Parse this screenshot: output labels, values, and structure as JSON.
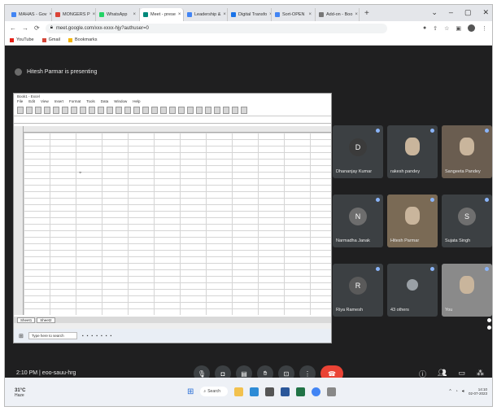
{
  "browser": {
    "tabs": [
      {
        "label": "MAHAS - Gov",
        "fav": "#4285f4"
      },
      {
        "label": "MONGERS P",
        "fav": "#db4437"
      },
      {
        "label": "WhatsApp",
        "fav": "#25d366"
      },
      {
        "label": "Meet - prese",
        "fav": "#00897b",
        "active": true
      },
      {
        "label": "Leadership &",
        "fav": "#4285f4"
      },
      {
        "label": "Digital Transfo",
        "fav": "#1a73e8"
      },
      {
        "label": "Sort-OPEN",
        "fav": "#4285f4"
      },
      {
        "label": "Add-on - Boo",
        "fav": "#777777"
      }
    ],
    "url": "meet.google.com/xxx-xxxx-hjy?authuser=0",
    "bookmarks": [
      "YouTube",
      "Gmail",
      "Bookmarks"
    ]
  },
  "meet": {
    "presenter_banner": "Hitesh Parmar is presenting",
    "spreadsheet": {
      "title": "Book1 - Excel",
      "menu": [
        "File",
        "Edit",
        "View",
        "Insert",
        "Format",
        "Tools",
        "Data",
        "Window",
        "Help"
      ],
      "sheet_tabs": [
        "Sheet1",
        "Sheet2"
      ],
      "taskbar_search": "Type here to search"
    },
    "participants": [
      {
        "name": "Dhananjay Kumar",
        "initial": "D",
        "color": "#3b3b3b",
        "type": "avatar"
      },
      {
        "name": "rakesh pandey",
        "initial": "",
        "color": "#3c4043",
        "type": "photo"
      },
      {
        "name": "Sangeeta Pandey",
        "initial": "",
        "color": "#6a5d50",
        "type": "video"
      },
      {
        "name": "Narmadha Janak",
        "initial": "N",
        "color": "#6d6d6d",
        "type": "avatar"
      },
      {
        "name": "Hitesh Parmar",
        "initial": "",
        "color": "#7a6a55",
        "type": "video"
      },
      {
        "name": "Sujata Singh",
        "initial": "S",
        "color": "#6f6f6f",
        "type": "avatar"
      },
      {
        "name": "Riya Ramesh",
        "initial": "R",
        "color": "#5a5a5a",
        "type": "avatar"
      },
      {
        "name": "43 others",
        "initial": "",
        "color": "#3c4043",
        "type": "others"
      },
      {
        "name": "You",
        "initial": "",
        "color": "#8a8a8a",
        "type": "video"
      }
    ],
    "time": "2:10 PM",
    "meeting_code": "eoo-sauu-hrg"
  },
  "windows": {
    "weather_temp": "31°C",
    "weather_desc": "Haze",
    "search_label": "Search",
    "clock_time": "14:10",
    "clock_date": "02-07-2023"
  }
}
